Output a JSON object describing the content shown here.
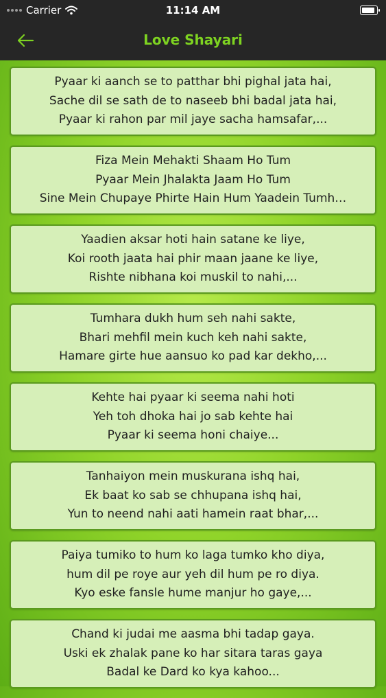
{
  "status": {
    "carrier": "Carrier",
    "time": "11:14 AM"
  },
  "nav": {
    "title": "Love Shayari",
    "back_icon": "arrow-left-icon",
    "accent": "#7ed321"
  },
  "items": [
    {
      "lines": [
        "Pyaar ki aanch se to patthar bhi pighal jata hai,",
        "Sache dil se sath de to naseeb bhi badal jata hai,",
        "Pyaar ki rahon par mil jaye sacha hamsafar,..."
      ]
    },
    {
      "lines": [
        "Fiza Mein Mehakti Shaam Ho Tum",
        "Pyaar Mein Jhalakta Jaam Ho Tum",
        "Sine Mein Chupaye Phirte Hain Hum Yaadein Tumh…"
      ]
    },
    {
      "lines": [
        "Yaadien aksar hoti hain satane ke liye,",
        "Koi rooth jaata hai phir maan jaane ke liye,",
        "Rishte nibhana koi muskil to nahi,..."
      ]
    },
    {
      "lines": [
        "Tumhara dukh hum seh nahi sakte,",
        "Bhari mehfil mein kuch keh nahi sakte,",
        "Hamare girte hue aansuo ko pad kar dekho,..."
      ]
    },
    {
      "lines": [
        "Kehte hai pyaar ki seema nahi hoti",
        "Yeh toh dhoka hai jo sab kehte hai",
        "Pyaar ki seema honi chaiye..."
      ]
    },
    {
      "lines": [
        "Tanhaiyon mein muskurana ishq hai,",
        "Ek baat ko sab se chhupana ishq hai,",
        "Yun to neend nahi aati hamein raat bhar,..."
      ]
    },
    {
      "lines": [
        "Paiya tumiko to hum ko laga tumko kho diya,",
        "hum dil pe roye aur yeh dil hum pe ro diya.",
        "Kyo eske fansle hume manjur ho gaye,..."
      ]
    },
    {
      "lines": [
        "Chand ki judai me aasma bhi tadap gaya.",
        "Uski ek zhalak pane ko har sitara taras gaya",
        "Badal ke Dard ko kya kahoo..."
      ]
    }
  ]
}
